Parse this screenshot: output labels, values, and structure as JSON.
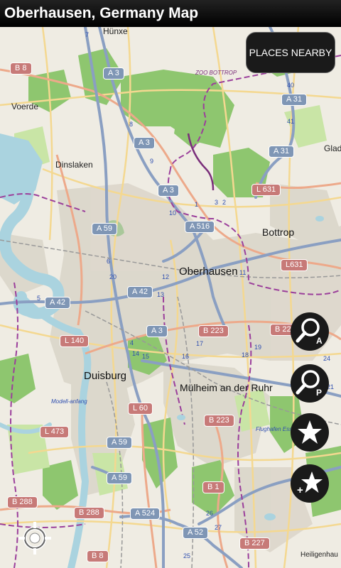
{
  "app": {
    "title": "Oberhausen, Germany Map"
  },
  "buttons": {
    "places_nearby": "PLACES NEARBY",
    "search_address_icon": "magnifier-a-icon",
    "search_places_icon": "magnifier-p-icon",
    "favorites_icon": "star-icon",
    "add_favorite_icon": "add-star-icon",
    "locate_icon": "crosshair-location-icon"
  },
  "map": {
    "towns": {
      "oberhausen": "Oberhausen",
      "duisburg": "Duisburg",
      "muelheim": "Mülheim an der Ruhr",
      "bottrop": "Bottrop",
      "dinslaken": "Dinslaken",
      "voerde": "Voerde",
      "huenxe": "Hünxe",
      "gladbeck": "Gladb",
      "heiligenhaus": "Heiligenhau"
    },
    "road_shields": {
      "a3_top": "A 3",
      "a3_mid": "A 3",
      "a3_b": "A 3",
      "a3_c": "A 3",
      "a31_top": "A 31",
      "a31_mid": "A 31",
      "a59_a": "A 59",
      "a59_b": "A 59",
      "a59_c": "A 59",
      "a516": "A 516",
      "a42_a": "A 42",
      "a42_b": "A 42",
      "a524": "A 524",
      "a52": "A 52",
      "b8_top": "B 8",
      "b8_bottom": "B 8",
      "l631_a": "L 631",
      "l631_b": "L631",
      "b223_a": "B 223",
      "b223_b": "B 223",
      "b223_c": "B 22",
      "l140": "L 140",
      "l60": "L 60",
      "l473": "L 473",
      "b288_a": "B 288",
      "b288_b": "B 288",
      "b1": "B 1",
      "b227": "B 227"
    },
    "small_labels": {
      "zoo": "ZOO BOTTROP",
      "modellflug": "Modell-anfang",
      "flughafen": "Flughafen Essen"
    },
    "exit_numbers": [
      "7",
      "8",
      "9",
      "40",
      "41",
      "1",
      "2",
      "3",
      "10",
      "11",
      "12",
      "13",
      "14",
      "15",
      "16",
      "17",
      "18",
      "19",
      "4",
      "5",
      "6",
      "20",
      "21",
      "24",
      "25",
      "26",
      "27"
    ]
  },
  "colors": {
    "water": "#aad3df",
    "forest": "#8dc56c",
    "park": "#c8e4a5",
    "urban": "#ddd9cf",
    "motorway": "#8a9fc2",
    "primary": "#f3b38d",
    "secondary": "#f7d79a",
    "boundary": "#9b3f9b"
  }
}
